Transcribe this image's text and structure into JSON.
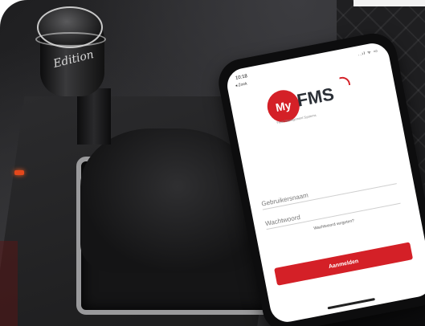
{
  "scene": {
    "knob_brand": "Edition"
  },
  "phone": {
    "status_time": "10:18",
    "status_right": "..ıl ᯤ ▭",
    "back_label": "◂ Zoek",
    "logo": {
      "my": "My",
      "fms": "FMS",
      "tagline": "Fleet Management Systems"
    },
    "username_placeholder": "Gebruikersnaam",
    "password_placeholder": "Wachtwoord",
    "forgot_password": "Wachtwoord vergeten?",
    "login_button": "Aanmelden",
    "accent_color": "#d42027"
  }
}
